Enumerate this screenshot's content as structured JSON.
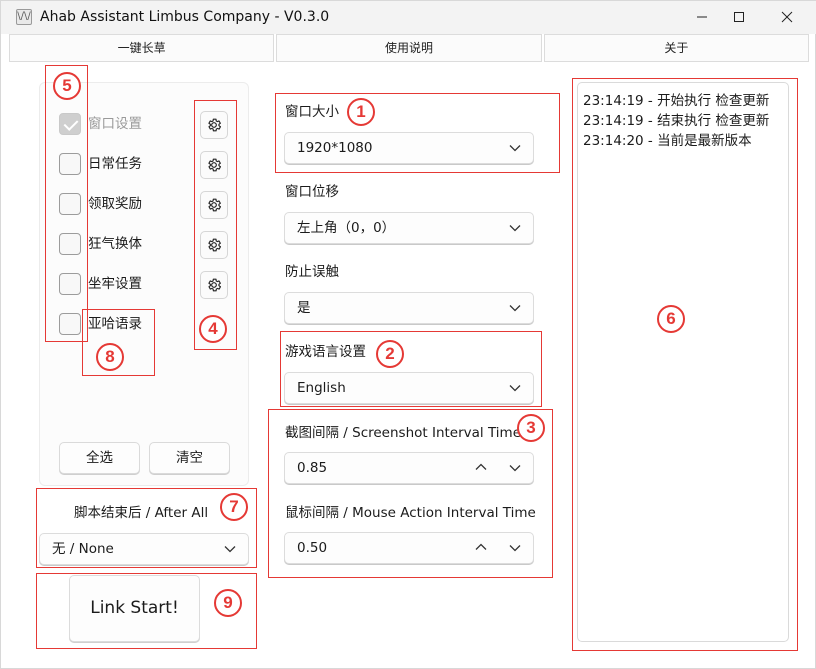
{
  "window": {
    "title": "Ahab Assistant Limbus Company -  V0.3.0",
    "app_icon_glyph": "\\/\\/",
    "controls": {
      "minimize": "minimize-icon",
      "maximize": "maximize-icon",
      "close": "close-icon"
    }
  },
  "tabs": [
    {
      "label": "一键长草"
    },
    {
      "label": "使用说明"
    },
    {
      "label": "关于"
    }
  ],
  "tasks": [
    {
      "label": "窗口设置",
      "checked": true,
      "disabled": true
    },
    {
      "label": "日常任务",
      "checked": false,
      "disabled": false,
      "settings_icon": "gear-icon"
    },
    {
      "label": "领取奖励",
      "checked": false,
      "disabled": false,
      "settings_icon": "gear-icon"
    },
    {
      "label": "狂气换体",
      "checked": false,
      "disabled": false,
      "settings_icon": "gear-icon"
    },
    {
      "label": "坐牢设置",
      "checked": false,
      "disabled": false,
      "settings_icon": "gear-icon"
    },
    {
      "label": "亚哈语录",
      "checked": false,
      "disabled": false
    }
  ],
  "task_buttons": {
    "select_all": "全选",
    "clear": "清空"
  },
  "after_all": {
    "label": "脚本结束后 / After All",
    "value": "无 / None"
  },
  "start_button": "Link Start!",
  "settings": {
    "window_size": {
      "label": "窗口大小",
      "value": "1920*1080"
    },
    "window_offset": {
      "label": "窗口位移",
      "value": "左上角（0，0）"
    },
    "prevent_misclick": {
      "label": "防止误触",
      "value": "是"
    },
    "game_language": {
      "label": "游戏语言设置",
      "value": "English"
    },
    "screenshot_interval": {
      "label": "截图间隔 / Screenshot Interval Time",
      "value": "0.85"
    },
    "mouse_interval": {
      "label": "鼠标间隔 / Mouse Action Interval Time",
      "value": "0.50"
    }
  },
  "log": [
    "23:14:19 - 开始执行 检查更新",
    "23:14:19 - 结束执行 检查更新",
    "23:14:20 - 当前是最新版本"
  ],
  "annotations": {
    "color": "#e53935",
    "badges": [
      "1",
      "2",
      "3",
      "4",
      "5",
      "6",
      "7",
      "8",
      "9"
    ]
  }
}
